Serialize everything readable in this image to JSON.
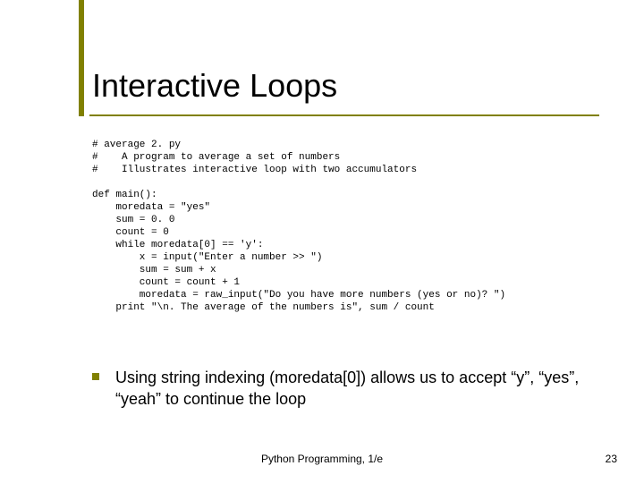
{
  "title": "Interactive Loops",
  "code": "# average 2. py\n#    A program to average a set of numbers\n#    Illustrates interactive loop with two accumulators\n\ndef main():\n    moredata = \"yes\"\n    sum = 0. 0\n    count = 0\n    while moredata[0] == 'y':\n        x = input(\"Enter a number >> \")\n        sum = sum + x\n        count = count + 1\n        moredata = raw_input(\"Do you have more numbers (yes or no)? \")\n    print \"\\n. The average of the numbers is\", sum / count",
  "bullet": "Using string indexing (moredata[0]) allows us to accept “y”, “yes”, “yeah” to continue the loop",
  "footer_center": "Python Programming, 1/e",
  "footer_right": "23"
}
